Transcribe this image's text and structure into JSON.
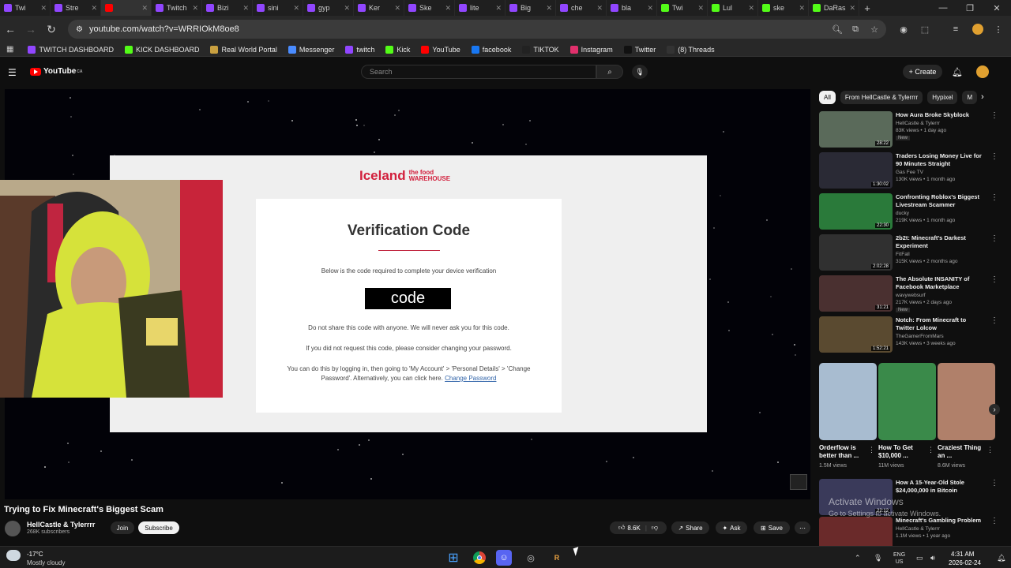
{
  "browser": {
    "tabs": [
      {
        "label": "Twi",
        "color": "#9146ff"
      },
      {
        "label": "Stre",
        "color": "#9146ff"
      },
      {
        "label": "",
        "color": "#ff0000"
      },
      {
        "label": "Twitch",
        "color": "#9146ff"
      },
      {
        "label": "Bizi",
        "color": "#9146ff"
      },
      {
        "label": "sini",
        "color": "#9146ff"
      },
      {
        "label": "gyp",
        "color": "#9146ff"
      },
      {
        "label": "Ker",
        "color": "#9146ff"
      },
      {
        "label": "Ske",
        "color": "#9146ff"
      },
      {
        "label": "lite",
        "color": "#9146ff"
      },
      {
        "label": "Big",
        "color": "#9146ff"
      },
      {
        "label": "che",
        "color": "#9146ff"
      },
      {
        "label": "bla",
        "color": "#9146ff"
      },
      {
        "label": "Twi",
        "color": "#53fc18"
      },
      {
        "label": "Lul",
        "color": "#53fc18"
      },
      {
        "label": "ske",
        "color": "#53fc18"
      },
      {
        "label": "DaRas",
        "color": "#53fc18"
      }
    ],
    "url": "youtube.com/watch?v=WRRIOkM8oe8",
    "bookmarks": [
      {
        "label": "TWITCH DASHBOARD",
        "color": "#9146ff"
      },
      {
        "label": "KICK DASHBOARD",
        "color": "#53fc18"
      },
      {
        "label": "Real World Portal",
        "color": "#c9a040"
      },
      {
        "label": "Messenger",
        "color": "#4a8cff"
      },
      {
        "label": "twitch",
        "color": "#9146ff"
      },
      {
        "label": "Kick",
        "color": "#53fc18"
      },
      {
        "label": "YouTube",
        "color": "#ff0000"
      },
      {
        "label": "facebook",
        "color": "#1877f2"
      },
      {
        "label": "TIKTOK",
        "color": "#222222"
      },
      {
        "label": "Instagram",
        "color": "#e1306c"
      },
      {
        "label": "Twitter",
        "color": "#111111"
      },
      {
        "label": "(8) Threads",
        "color": "#333333"
      }
    ]
  },
  "youtube": {
    "logo": "YouTube",
    "country": "CA",
    "search_placeholder": "Search",
    "create_label": "Create"
  },
  "email": {
    "brand": "Iceland",
    "brand_sub1": "the food",
    "brand_sub2": "WAREHOUSE",
    "title": "Verification Code",
    "desc": "Below is the code required to complete your device verification",
    "code": "code",
    "p1": "Do not share this code with anyone. We will never ask you for this code.",
    "p2": "If you did not request this code, please consider changing your password.",
    "p3": "You can do this by logging in, then going to 'My Account' > 'Personal Details' > 'Change Password'. Alternatively, you can click here.",
    "p3_link": "Change Password"
  },
  "video": {
    "title": "Trying to Fix Minecraft's Biggest Scam",
    "channel": "HellCastle & Tylerrrr",
    "subscribers": "268K subscribers",
    "join": "Join",
    "subscribe": "Subscribe",
    "likes": "8.6K",
    "share": "Share",
    "ask": "Ask",
    "save": "Save"
  },
  "chips": [
    "All",
    "From HellCastle & Tylerrrr",
    "Hypixel",
    "M"
  ],
  "recommendations": [
    {
      "title": "How Aura Broke Skyblock",
      "channel": "HellCastle & Tylerrr",
      "meta": "83K views • 1 day ago",
      "badge": "New",
      "duration": "28:22",
      "thumb": "#5a6a5a"
    },
    {
      "title": "Traders Losing Money Live for 90 Minutes Straight",
      "channel": "Gas Fee TV",
      "meta": "130K views • 1 month ago",
      "badge": "",
      "duration": "1:30:02",
      "thumb": "#2a2a35"
    },
    {
      "title": "Confronting Roblox's Biggest Livestream Scammer",
      "channel": "ducky",
      "meta": "219K views • 1 month ago",
      "badge": "",
      "duration": "22:30",
      "thumb": "#2a7a3a"
    },
    {
      "title": "2b2t: Minecraft's Darkest Experiment",
      "channel": "FitFall",
      "meta": "315K views • 2 months ago",
      "badge": "",
      "duration": "2:02:28",
      "thumb": "#303030"
    },
    {
      "title": "The Absolute INSANITY of Facebook Marketplace",
      "channel": "wavywebsurf",
      "meta": "217K views • 2 days ago",
      "badge": "New",
      "duration": "31:21",
      "thumb": "#4a3030"
    },
    {
      "title": "Notch: From Minecraft to Twitter Lolcow",
      "channel": "TheGamerFromMars",
      "meta": "143K views • 3 weeks ago",
      "badge": "",
      "duration": "1:52:21",
      "thumb": "#5a4a30"
    },
    {
      "title": "How A 15-Year-Old Stole $24,000,000 in Bitcoin",
      "channel": "",
      "meta": "",
      "badge": "",
      "duration": "22:12",
      "thumb": "#3a3a5a"
    },
    {
      "title": "Minecraft's Gambling Problem",
      "channel": "HellCastle & Tylerrr",
      "meta": "1.1M views • 1 year ago",
      "badge": "",
      "duration": "",
      "thumb": "#6a2a2a"
    }
  ],
  "shorts": [
    {
      "title": "Orderflow is better than ...",
      "views": "1.5M views",
      "thumb": "#a8bcd0"
    },
    {
      "title": "How To Get $10,000 ...",
      "views": "11M views",
      "thumb": "#3a8a4a"
    },
    {
      "title": "Craziest Thing an ...",
      "views": "8.6M views",
      "thumb": "#b0806a"
    }
  ],
  "watermark": {
    "line1": "Activate Windows",
    "line2": "Go to Settings to activate Windows."
  },
  "taskbar": {
    "temp": "-17°C",
    "weather": "Mostly cloudy",
    "lang1": "ENG",
    "lang2": "US",
    "time": "4:31 AM",
    "date": "2026-02-24"
  }
}
